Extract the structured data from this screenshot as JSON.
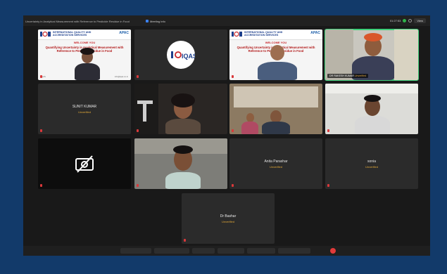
{
  "topbar": {
    "meeting_title": "Uncertainty in Analytical Measurement with Reference to Pesticide Residue in Food",
    "status_label": "Meeting info",
    "timer": "01:27:53",
    "view_label": "View"
  },
  "slide": {
    "org_line1": "INTERNATIONAL QUALITY AND",
    "org_line2": "ACCREDITATION SERVICES",
    "brand": "APAC",
    "welcome": "WELCOME YOU",
    "title": "Quantifying Uncertainty in Analytical Measurement with Reference to Pesticide Residue in Food",
    "footer_left": "IQAS",
    "footer_right": "info@iqas.co.in"
  },
  "logo_text": "IQAS",
  "participants": [
    {
      "id": "slide-a"
    },
    {
      "id": "logo"
    },
    {
      "id": "slide-b"
    },
    {
      "id": "speaker",
      "name": "DR RAKESH KUMAR",
      "status": "Unverified"
    },
    {
      "id": "sunit",
      "name": "SUNIT KUMAR",
      "status": "Unverified"
    },
    {
      "id": "video-woman"
    },
    {
      "id": "video-group"
    },
    {
      "id": "video-bearded"
    },
    {
      "id": "camoff"
    },
    {
      "id": "video-glasses"
    },
    {
      "id": "anita",
      "name": "Anita Parashar",
      "status": "Unverified"
    },
    {
      "id": "sonia",
      "name": "sonia",
      "status": "Unverified"
    },
    {
      "id": "bashar",
      "name": "Dr Bashar",
      "status": "Unverified"
    }
  ],
  "colors": {
    "frame": "#123a6a",
    "app_bg": "#191919",
    "tile_bg": "#2b2b2b",
    "unverified": "#e3a937",
    "active_border": "#3fd07a"
  }
}
